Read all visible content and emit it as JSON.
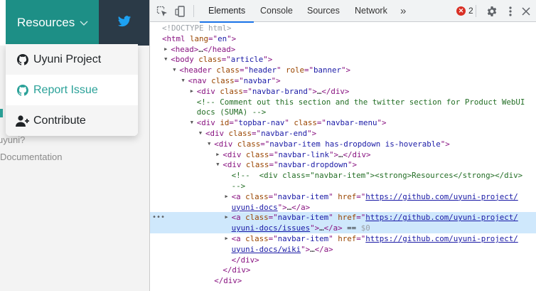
{
  "page": {
    "resources_label": "Resources",
    "dropdown": [
      {
        "label": "Uyuni Project",
        "icon": "github-icon"
      },
      {
        "label": "Report Issue",
        "icon": "github-icon"
      },
      {
        "label": "Contribute",
        "icon": "user-plus-icon"
      }
    ],
    "side_text_1": "uyuni?",
    "side_text_2": "Documentation"
  },
  "devtools": {
    "tabs": [
      "Elements",
      "Console",
      "Sources",
      "Network"
    ],
    "more_label": "»",
    "error_count": "2",
    "lines": [
      {
        "indent": 0,
        "html": "<span class='dim'>&lt;!DOCTYPE html&gt;</span>"
      },
      {
        "indent": 0,
        "html": "<span class='tag'>&lt;html</span> <span class='an'>lang</span><span class='tag'>=\"</span><span class='av'>en</span><span class='tag'>\"&gt;</span>"
      },
      {
        "indent": 1,
        "tri": "▶",
        "html": "<span class='tag'>&lt;head&gt;</span>…<span class='tag'>&lt;/head&gt;</span>"
      },
      {
        "indent": 1,
        "tri": "▼",
        "html": "<span class='tag'>&lt;body</span> <span class='an'>class</span><span class='tag'>=\"</span><span class='av'>article</span><span class='tag'>\"&gt;</span>"
      },
      {
        "indent": 2,
        "tri": "▼",
        "html": "<span class='tag'>&lt;header</span> <span class='an'>class</span><span class='tag'>=\"</span><span class='av'>header</span><span class='tag'>\"</span> <span class='an'>role</span><span class='tag'>=\"</span><span class='av'>banner</span><span class='tag'>\"&gt;</span>"
      },
      {
        "indent": 3,
        "tri": "▼",
        "html": "<span class='tag'>&lt;nav</span> <span class='an'>class</span><span class='tag'>=\"</span><span class='av'>navbar</span><span class='tag'>\"&gt;</span>"
      },
      {
        "indent": 4,
        "tri": "▶",
        "html": "<span class='tag'>&lt;div</span> <span class='an'>class</span><span class='tag'>=\"</span><span class='av'>navbar-brand</span><span class='tag'>\"&gt;</span>…<span class='tag'>&lt;/div&gt;</span>"
      },
      {
        "indent": 4,
        "html": "<span class='cm'>&lt;!-- Comment out this section and the twitter section for Product WebUI</span>"
      },
      {
        "indent": 4,
        "html": "<span class='cm'>docs (SUMA) --&gt;</span>"
      },
      {
        "indent": 4,
        "tri": "▼",
        "html": "<span class='tag'>&lt;div</span> <span class='an'>id</span><span class='tag'>=\"</span><span class='av'>topbar-nav</span><span class='tag'>\"</span> <span class='an'>class</span><span class='tag'>=\"</span><span class='av'>navbar-menu</span><span class='tag'>\"&gt;</span>"
      },
      {
        "indent": 5,
        "tri": "▼",
        "html": "<span class='tag'>&lt;div</span> <span class='an'>class</span><span class='tag'>=\"</span><span class='av'>navbar-end</span><span class='tag'>\"&gt;</span>"
      },
      {
        "indent": 6,
        "tri": "▼",
        "html": "<span class='tag'>&lt;div</span> <span class='an'>class</span><span class='tag'>=\"</span><span class='av'>navbar-item has-dropdown is-hoverable</span><span class='tag'>\"&gt;</span>"
      },
      {
        "indent": 7,
        "tri": "▶",
        "html": "<span class='tag'>&lt;div</span> <span class='an'>class</span><span class='tag'>=\"</span><span class='av'>navbar-link</span><span class='tag'>\"&gt;</span>…<span class='tag'>&lt;/div&gt;</span>"
      },
      {
        "indent": 7,
        "tri": "▼",
        "html": "<span class='tag'>&lt;div</span> <span class='an'>class</span><span class='tag'>=\"</span><span class='av'>navbar-dropdown</span><span class='tag'>\"&gt;</span>"
      },
      {
        "indent": 8,
        "html": "<span class='cm'>&lt;!--  &lt;div class=\"navbar-item\"&gt;&lt;strong&gt;Resources&lt;/strong&gt;&lt;/div&gt;</span>"
      },
      {
        "indent": 8,
        "html": "<span class='cm'>--&gt;</span>"
      },
      {
        "indent": 8,
        "tri": "▶",
        "html": "<span class='tag'>&lt;a</span> <span class='an'>class</span><span class='tag'>=\"</span><span class='av'>navbar-item</span><span class='tag'>\"</span> <span class='an'>href</span><span class='tag'>=\"</span><span class='lnk'>https://github.com/uyuni-project/</span>"
      },
      {
        "indent": 8,
        "html": "<span class='lnk'>uyuni-docs</span><span class='tag'>\"&gt;</span>…<span class='tag'>&lt;/a&gt;</span>"
      },
      {
        "indent": 8,
        "tri": "▶",
        "sel": true,
        "html": "<span class='tag'>&lt;a</span> <span class='an'>class</span><span class='tag'>=\"</span><span class='av'>navbar-item</span><span class='tag'>\"</span> <span class='an'>href</span><span class='tag'>=\"</span><span class='lnk'>https://github.com/uyuni-project/</span>"
      },
      {
        "indent": 8,
        "sel": true,
        "html": "<span class='lnk'>uyuni-docs/issues</span><span class='tag'>\"&gt;</span>…<span class='tag'>&lt;/a&gt;</span> <span class='plain'>== </span><span class='dim'>$0</span>"
      },
      {
        "indent": 8,
        "tri": "▶",
        "html": "<span class='tag'>&lt;a</span> <span class='an'>class</span><span class='tag'>=\"</span><span class='av'>navbar-item</span><span class='tag'>\"</span> <span class='an'>href</span><span class='tag'>=\"</span><span class='lnk'>https://github.com/uyuni-project/</span>"
      },
      {
        "indent": 8,
        "html": "<span class='lnk'>uyuni-docs/wiki</span><span class='tag'>\"&gt;</span>…<span class='tag'>&lt;/a&gt;</span>"
      },
      {
        "indent": 8,
        "html": "<span class='tag'>&lt;/div&gt;</span>"
      },
      {
        "indent": 7,
        "html": "<span class='tag'>&lt;/div&gt;</span>"
      },
      {
        "indent": 6,
        "html": "<span class='tag'>&lt;/div&gt;</span>"
      }
    ]
  }
}
